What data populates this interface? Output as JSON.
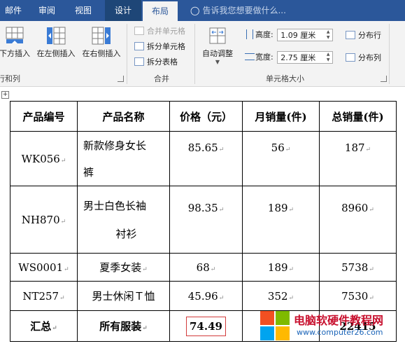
{
  "tabs": {
    "mail": "邮件",
    "review": "审阅",
    "view": "视图",
    "design": "设计",
    "layout": "布局"
  },
  "tell_me": "告诉我您想要做什么...",
  "ribbon": {
    "rows_cols": {
      "insert_below": "下方插入",
      "insert_left": "在左侧插入",
      "insert_right": "在右侧插入",
      "group_label": "行和列"
    },
    "merge": {
      "merge_cells": "合并单元格",
      "split_cells": "拆分单元格",
      "split_table": "拆分表格",
      "group_label": "合并"
    },
    "cell_size": {
      "autofit": "自动调整",
      "height_label": "高度:",
      "height_value": "1.09 厘米",
      "width_label": "宽度:",
      "width_value": "2.75 厘米",
      "distribute_rows": "分布行",
      "distribute_cols": "分布列",
      "group_label": "单元格大小"
    }
  },
  "table": {
    "headers": [
      "产品编号",
      "产品名称",
      "价格（元）",
      "月销量(件)",
      "总销量(件)"
    ],
    "rows": [
      {
        "code": "WK056",
        "name_line1": "新款修身女长",
        "name_line2": "裤",
        "price": "85.65",
        "monthly": "56",
        "total": "187"
      },
      {
        "code": "NH870",
        "name_line1": "男士白色长袖",
        "name_line2": "衬衫",
        "price": "98.35",
        "monthly": "189",
        "total": "8960"
      },
      {
        "code": "WS0001",
        "name_line1": "夏季女装",
        "name_line2": "",
        "price": "68",
        "monthly": "189",
        "total": "5738"
      },
      {
        "code": "NT257",
        "name_line1": "男士休闲Ｔ恤",
        "name_line2": "",
        "price": "45.96",
        "monthly": "352",
        "total": "7530"
      }
    ],
    "summary": {
      "label": "汇总",
      "name": "所有服装",
      "price": "74.49",
      "total": "22415"
    }
  },
  "watermark": {
    "title": "电脑软硬件教程网",
    "url": "www.computer26.com"
  },
  "colors": {
    "tabbar": "#2b579a",
    "ribbon_bg": "#f3f3f3",
    "highlight_border": "#d23b3b"
  }
}
